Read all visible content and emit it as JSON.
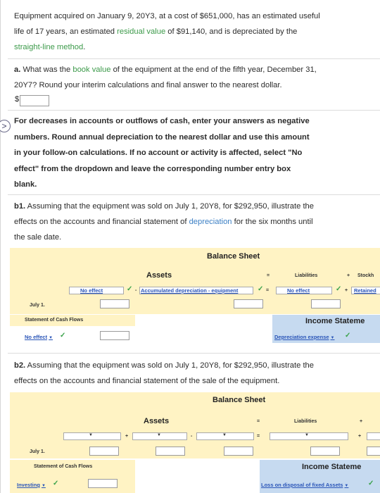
{
  "intro": {
    "line1": "Equipment acquired on January 9, 20Y3, at a cost of $651,000, has an estimated useful",
    "line2_pre": "life of 17 years, an estimated ",
    "line2_link": "residual value",
    "line2_post": " of $91,140, and is depreciated by the",
    "line3_link": "straight-line method",
    "line3_post": "."
  },
  "question_a": {
    "label": "a.",
    "line1_pre": " What was the ",
    "line1_link": "book value",
    "line1_post": " of the equipment at the end of the fifth year, December 31,",
    "line2": "20Y7? Round your interim calculations and final answer to the nearest dollar.",
    "currency": "$"
  },
  "instructions": {
    "line1": "For decreases in accounts or outflows of cash, enter your answers as negative",
    "line2": "numbers. Round annual depreciation to the nearest dollar and use this amount",
    "line3": "in your follow-on calculations. If no account or activity is affected, select \"No",
    "line4": "effect\" from the dropdown and leave the corresponding number entry box",
    "line5": "blank."
  },
  "question_b1": {
    "label": "b1.",
    "line1": " Assuming that the equipment was sold on July 1, 20Y8, for $292,950, illustrate the",
    "line2_pre": "effects on the accounts and financial statement of ",
    "line2_link": "depreciation",
    "line2_post": " for the six months until",
    "line3": "the sale date."
  },
  "table_b1": {
    "balance_sheet": "Balance Sheet",
    "assets": "Assets",
    "equals": "=",
    "liabilities": "Liabilities",
    "plus": "+",
    "stockholders": "Stockh",
    "asset_dd1": "No effect",
    "minus": "-",
    "asset_dd2": "Accumulated depreciation - equipment",
    "liab_dd": "No effect",
    "equity_dd": "Retained",
    "date": "July 1.",
    "cash_flows": "Statement of Cash Flows",
    "cash_dd": "No effect",
    "income": "Income Stateme",
    "income_dd": "Depreciation expense"
  },
  "question_b2": {
    "label": "b2.",
    "line1": " Assuming that the equipment was sold on July 1, 20Y8, for $292,950, illustrate the",
    "line2": "effects on the accounts and financial statement of the sale of the equipment."
  },
  "table_b2": {
    "balance_sheet": "Balance Sheet",
    "assets": "Assets",
    "equals": "=",
    "liabilities": "Liabilities",
    "plus": "+",
    "minus": "-",
    "date": "July 1.",
    "cash_flows": "Statement of Cash Flows",
    "cash_dd": "Investing",
    "income": "Income Stateme",
    "income_dd": "Loss on disposal of fixed Assets"
  }
}
